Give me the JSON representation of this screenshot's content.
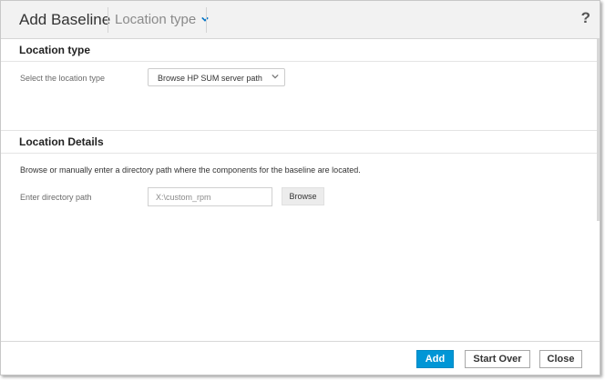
{
  "dialog": {
    "title": "Add Baseline",
    "breadcrumb": "Location type",
    "help_label": "?"
  },
  "location_type": {
    "section_title": "Location type",
    "select_label": "Select the location type",
    "select_value": "Browse HP SUM server path"
  },
  "location_details": {
    "section_title": "Location Details",
    "description": "Browse or manually enter a directory path where the components for the baseline are located.",
    "path_label": "Enter directory path",
    "path_value": "X:\\custom_rpm",
    "browse_label": "Browse"
  },
  "footer": {
    "add_label": "Add",
    "start_over_label": "Start Over",
    "close_label": "Close"
  },
  "colors": {
    "accent": "#0096d6",
    "header_bg": "#f2f2f2",
    "chevron": "#0073c6"
  },
  "icons": {
    "breadcrumb_chevron": "chevron-down-icon",
    "select_chevron": "chevron-down-icon",
    "help": "help-icon"
  }
}
